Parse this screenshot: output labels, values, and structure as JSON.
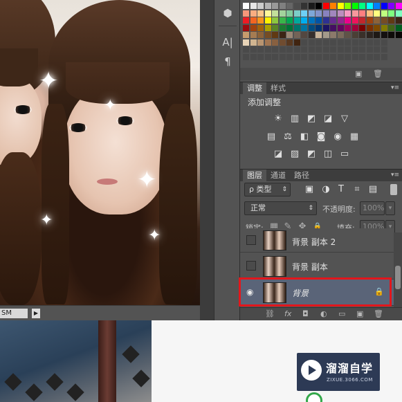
{
  "canvas": {
    "zoom_text": "SM",
    "nav_arrow": "▶"
  },
  "toolstrip": {
    "items": [
      {
        "name": "3d-object-icon",
        "glyph": "⬢"
      },
      {
        "name": "character-panel-icon",
        "glyph": "A|"
      },
      {
        "name": "paragraph-panel-icon",
        "glyph": "¶"
      }
    ]
  },
  "adjustments_panel": {
    "tabs": [
      "调整",
      "样式"
    ],
    "title": "添加调整",
    "row1": [
      "☀",
      "▥",
      "◩",
      "◪",
      "▽"
    ],
    "row2": [
      "▤",
      "⚖",
      "◧",
      "◙",
      "◉",
      "▦"
    ],
    "row3": [
      "◪",
      "▨",
      "◩",
      "◫",
      "▭"
    ]
  },
  "layers_panel": {
    "tabs": [
      "图层",
      "通道",
      "路径"
    ],
    "filter_label": "ρ 类型",
    "filter_icons": [
      "▣",
      "◑",
      "T",
      "⌗",
      "▤"
    ],
    "blend_mode": "正常",
    "opacity_label": "不透明度:",
    "opacity_value": "100%",
    "lock_label": "锁定:",
    "lock_icons": [
      "▦",
      "✎",
      "✥",
      "🔒"
    ],
    "fill_label": "填充:",
    "fill_value": "100%",
    "layers": [
      {
        "name": "背景 副本 2",
        "visible": false,
        "selected": false
      },
      {
        "name": "背景 副本",
        "visible": false,
        "selected": false
      },
      {
        "name": "背景",
        "visible": true,
        "selected": true,
        "locked": true
      }
    ],
    "footer_icons": [
      "⛓",
      "fx",
      "◘",
      "◐",
      "▭",
      "▣",
      "🗑"
    ]
  },
  "watermark": {
    "title": "溜溜自学",
    "subtitle": "ZIXUE.3066.COM"
  },
  "colors": {
    "selection_highlight": "#e3161b",
    "panel_bg": "#535353",
    "selected_layer": "#5a6478"
  }
}
